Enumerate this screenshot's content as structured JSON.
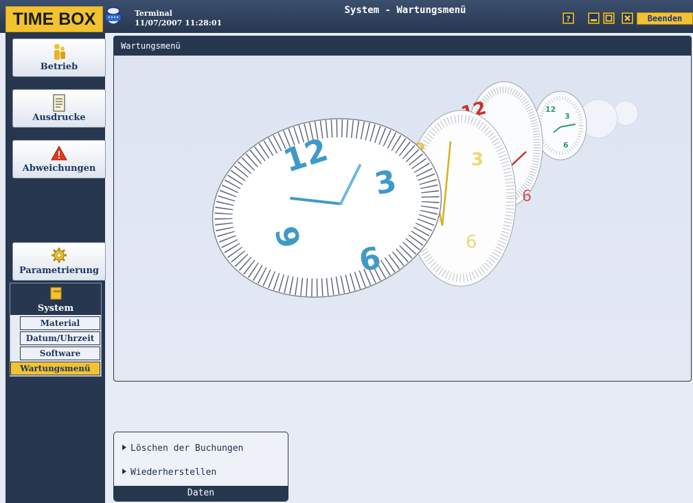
{
  "header": {
    "logo": "TIME BOX",
    "terminal_label": "Terminal",
    "datetime": "11/07/2007 11:28:01",
    "window_title": "System - Wartungsmenü",
    "quit_label": "Beenden",
    "buttons": {
      "help": "question-icon",
      "minimize": "minimize-icon",
      "maximize": "maximize-icon",
      "close": "close-icon"
    },
    "accent": "#f2c230",
    "dark": "#27374f"
  },
  "sidebar": {
    "items": [
      {
        "label": "Betrieb",
        "icon": "people-icon"
      },
      {
        "label": "Ausdrucke",
        "icon": "document-icon"
      },
      {
        "label": "Abweichungen",
        "icon": "warning-icon"
      },
      {
        "label": "Parametrierung",
        "icon": "gear-icon"
      }
    ],
    "system": {
      "label": "System",
      "icon": "folder-icon",
      "subitems": [
        "Material",
        "Datum/Uhrzeit",
        "Software",
        "Wartungsmenü"
      ],
      "active": "Wartungsmenü"
    }
  },
  "main": {
    "panel_title": "Wartungsmenü",
    "clock_numerals": {
      "twelve": "12",
      "three": "3",
      "six": "6",
      "nine": "9"
    }
  },
  "actions": {
    "items": [
      "Löschen der Buchungen",
      "Wiederherstellen"
    ],
    "footer": "Daten"
  }
}
